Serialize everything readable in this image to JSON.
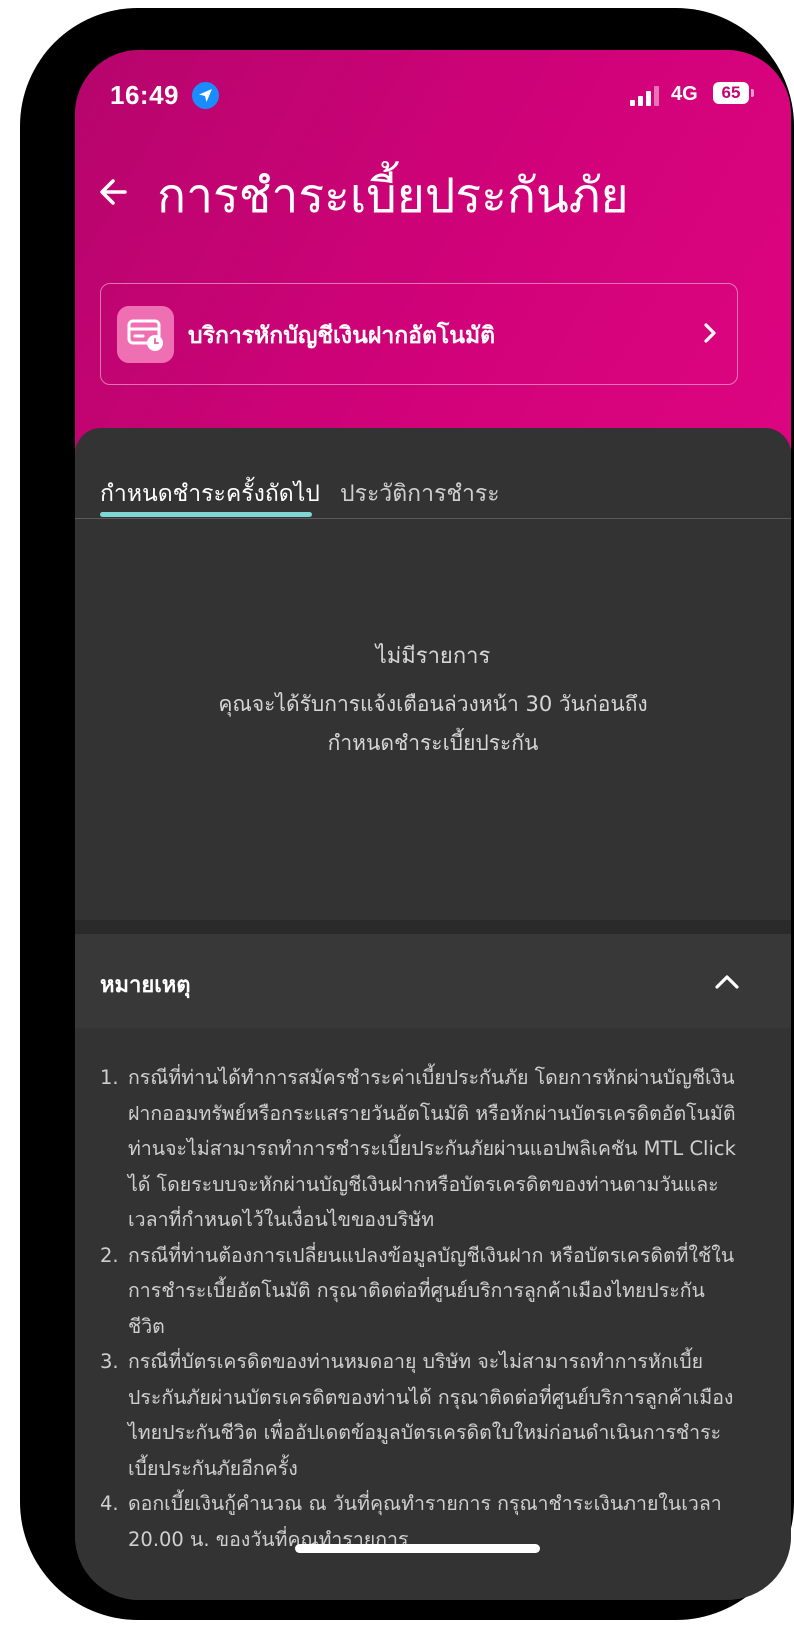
{
  "status_bar": {
    "time": "16:49",
    "network": "4G",
    "battery": "65"
  },
  "header": {
    "title": "การชำระเบี้ยประกันภัย"
  },
  "service_card": {
    "label": "บริการหักบัญชีเงินฝากอัตโนมัติ"
  },
  "tabs": [
    {
      "label": "กำหนดชำระครั้งถัดไป",
      "active": true
    },
    {
      "label": "ประวัติการชำระ",
      "active": false
    }
  ],
  "empty_state": {
    "title": "ไม่มีรายการ",
    "description": "คุณจะได้รับการแจ้งเตือนล่วงหน้า 30 วันก่อนถึงกำหนดชำระเบี้ยประกัน"
  },
  "remarks": {
    "title": "หมายเหตุ",
    "items": [
      {
        "number": "1.",
        "text": "กรณีที่ท่านได้ทำการสมัครชำระค่าเบี้ยประกันภัย โดยการหักผ่านบัญชีเงินฝากออมทรัพย์หรือกระแสรายวันอัตโนมัติ หรือหักผ่านบัตรเครดิตอัตโนมัติ ท่านจะไม่สามารถทำการชำระเบี้ยประกันภัยผ่านแอปพลิเคชัน MTL Click ได้ โดยระบบจะหักผ่านบัญชีเงินฝากหรือบัตรเครดิตของท่านตามวันและเวลาที่กำหนดไว้ในเงื่อนไขของบริษัท"
      },
      {
        "number": "2.",
        "text": "กรณีที่ท่านต้องการเปลี่ยนแปลงข้อมูลบัญชีเงินฝาก หรือบัตรเครดิตที่ใช้ในการชำระเบี้ยอัตโนมัติ กรุณาติดต่อที่ศูนย์บริการลูกค้าเมืองไทยประกันชีวิต"
      },
      {
        "number": "3.",
        "text": "กรณีที่บัตรเครดิตของท่านหมดอายุ บริษัท จะไม่สามารถทำการหักเบี้ยประกันภัยผ่านบัตรเครดิตของท่านได้ กรุณาติดต่อที่ศูนย์บริการลูกค้าเมืองไทยประกันชีวิต เพื่ออัปเดตข้อมูลบัตรเครดิตใบใหม่ก่อนดำเนินการชำระเบี้ยประกันภัยอีกครั้ง"
      },
      {
        "number": "4.",
        "text": "ดอกเบี้ยเงินกู้คำนวณ ณ วันที่คุณทำรายการ กรุณาชำระเงินภายในเวลา 20.00 น. ของวันที่คุณทำรายการ"
      }
    ]
  },
  "colors": {
    "header_gradient_start": "#b6056c",
    "header_gradient_end": "#dd0581",
    "panel_background": "#333333",
    "tab_underline": "#7fd6d2",
    "card_icon_bg": "#ef6fb3"
  },
  "icons": {
    "back": "arrow-left-icon",
    "location": "location-arrow-icon",
    "card": "credit-card-clock-icon",
    "chevron_right": "chevron-right-icon",
    "chevron_up": "chevron-up-icon"
  }
}
